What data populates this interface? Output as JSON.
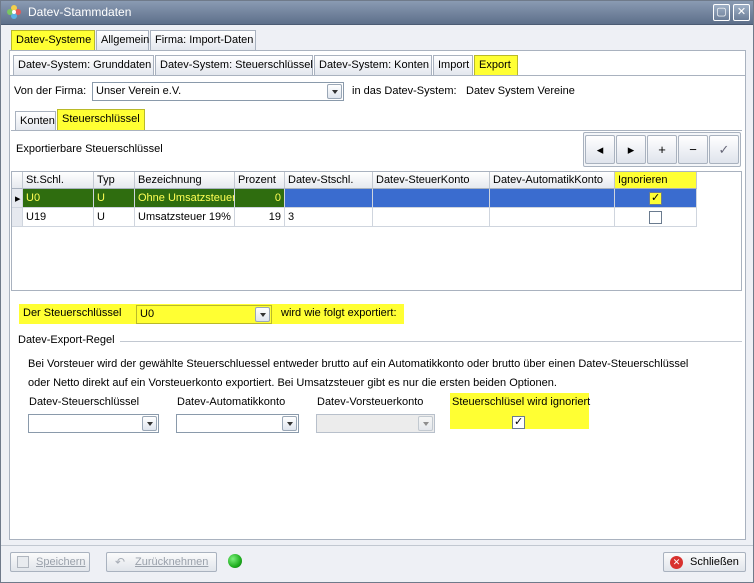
{
  "window": {
    "title": "Datev-Stammdaten"
  },
  "main_tabs": [
    "Datev-Systeme",
    "Allgemein",
    "Firma: Import-Daten"
  ],
  "sub_tabs": [
    "Datev-System: Grunddaten",
    "Datev-System: Steuerschlüssel",
    "Datev-System: Konten",
    "Import",
    "Export"
  ],
  "firm": {
    "label": "Von der Firma:",
    "value": "Unser Verein e.V.",
    "to_label": "in das Datev-System:",
    "system_value": "Datev System Vereine"
  },
  "inner_tabs": [
    "Konten",
    "Steuerschlüssel"
  ],
  "grid": {
    "title": "Exportierbare Steuerschlüssel",
    "columns": [
      "St.Schl.",
      "Typ",
      "Bezeichnung",
      "Prozent",
      "Datev-Stschl.",
      "Datev-SteuerKonto",
      "Datev-AutomatikKonto",
      "Ignorieren"
    ],
    "rows": [
      {
        "stschl": "U0",
        "typ": "U",
        "bez": "Ohne Umsatzsteuer",
        "prozent": "0",
        "datev_stschl": "",
        "steuerkonto": "",
        "automatikkonto": "",
        "ignorieren": true
      },
      {
        "stschl": "U19",
        "typ": "U",
        "bez": "Umsatzsteuer 19%",
        "prozent": "19",
        "datev_stschl": "3",
        "steuerkonto": "",
        "automatikkonto": "",
        "ignorieren": false
      }
    ]
  },
  "export": {
    "prefix": "Der Steuerschlüssel",
    "value": "U0",
    "suffix": "wird wie folgt exportiert:"
  },
  "rule": {
    "title": "Datev-Export-Regel",
    "text1": "Bei Vorsteuer wird der gewählte Steuerschluessel entweder brutto auf ein Automatikkonto oder brutto über einen Datev-Steuerschlüssel",
    "text2": "oder Netto direkt auf ein Vorsteuerkonto exportiert. Bei Umsatzsteuer gibt es nur die ersten beiden Optionen.",
    "field1": "Datev-Steuerschlüssel",
    "field2": "Datev-Automatikkonto",
    "field3": "Datev-Vorsteuerkonto",
    "field4": "Steuerschlüsel wird ignoriert"
  },
  "footer": {
    "save": "Speichern",
    "undo": "Zurücknehmen",
    "close": "Schließen"
  },
  "colors": {
    "highlight": "#ffff33",
    "selection": "#3a6ccf",
    "status": "#1fae1f"
  }
}
